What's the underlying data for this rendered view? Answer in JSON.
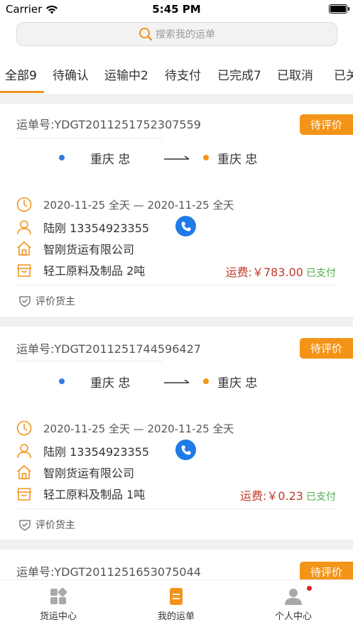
{
  "status_bar": {
    "carrier": "Carrier",
    "time": "5:45 PM"
  },
  "search": {
    "placeholder": "搜索我的运单"
  },
  "tabs": [
    {
      "label": "全部9",
      "active": true
    },
    {
      "label": "待确认"
    },
    {
      "label": "运输中2"
    },
    {
      "label": "待支付"
    },
    {
      "label": "已完成7"
    },
    {
      "label": "已取消"
    },
    {
      "label": "已关"
    }
  ],
  "orders": [
    {
      "order_no": "运单号:YDGT2011251752307559",
      "badge": "待评价",
      "from": "重庆 忠",
      "to": "重庆 忠",
      "date_range": "2020-11-25 全天 — 2020-11-25 全天",
      "contact": "陆刚 13354923355",
      "company": "智刚货运有限公司",
      "cargo": "轻工原料及制品  2吨",
      "fee": "运费:￥783.00",
      "pay_status": "已支付",
      "rate_label": "评价货主"
    },
    {
      "order_no": "运单号:YDGT2011251744596427",
      "badge": "待评价",
      "from": "重庆 忠",
      "to": "重庆 忠",
      "date_range": "2020-11-25 全天 — 2020-11-25 全天",
      "contact": "陆刚 13354923355",
      "company": "智刚货运有限公司",
      "cargo": "轻工原料及制品  1吨",
      "fee": "运费:￥0.23",
      "pay_status": "已支付",
      "rate_label": "评价货主"
    },
    {
      "order_no": "运单号:YDGT2011251653075044",
      "badge": "待评价"
    }
  ],
  "tabbar": [
    {
      "label": "货运中心"
    },
    {
      "label": "我的运单",
      "active": true
    },
    {
      "label": "个人中心",
      "has_notification": true
    }
  ],
  "colors": {
    "accent": "#f39419",
    "fee": "#c0392b",
    "paid": "#4cae4c",
    "phone": "#1e7be8",
    "origin_dot": "#2f7de1",
    "dest_dot": "#f39419"
  }
}
